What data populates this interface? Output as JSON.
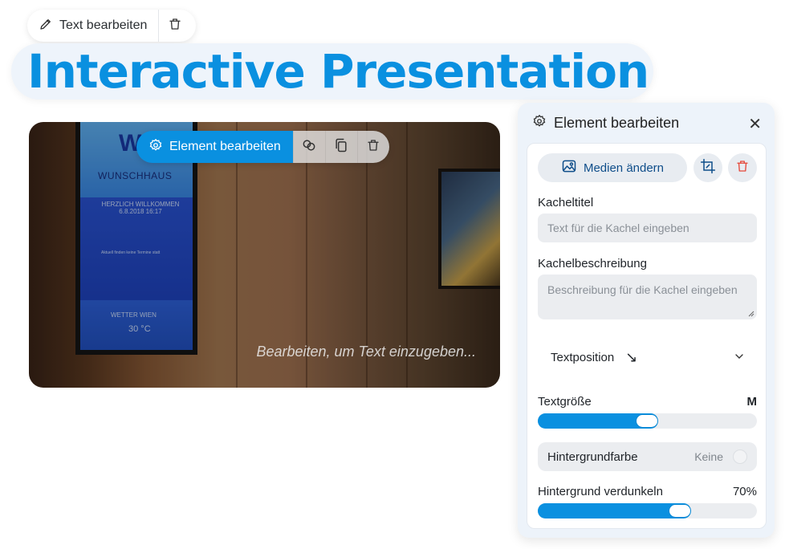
{
  "text_toolbar": {
    "edit_label": "Text bearbeiten"
  },
  "title": "Interactive Presentation",
  "tile": {
    "placeholder": "Bearbeiten, um Text einzugeben...",
    "screen": {
      "logo": "W",
      "name": "WUNSCHHAUS",
      "welcome": "HERZLICH WILLKOMMEN",
      "datetime": "6.8.2018 16:17",
      "info": "Aktuell finden keine Termine statt",
      "weather_title": "WETTER WIEN",
      "temp": "30 °C"
    }
  },
  "element_toolbar": {
    "edit_label": "Element bearbeiten"
  },
  "panel": {
    "title": "Element bearbeiten",
    "media_button": "Medien ändern",
    "tile_title_label": "Kacheltitel",
    "tile_title_placeholder": "Text für die Kachel eingeben",
    "tile_desc_label": "Kachelbeschreibung",
    "tile_desc_placeholder": "Beschreibung für die Kachel eingeben",
    "text_position_label": "Textposition",
    "text_position_value": "↘",
    "text_size_label": "Textgröße",
    "text_size_value": "M",
    "text_size_level": 0.55,
    "bg_color_label": "Hintergrundfarbe",
    "bg_color_value": "Keine",
    "darken_label": "Hintergrund verdunkeln",
    "darken_value": "70%",
    "darken_level": 0.7
  },
  "colors": {
    "accent": "#0a90e0",
    "danger": "#e5483a"
  }
}
